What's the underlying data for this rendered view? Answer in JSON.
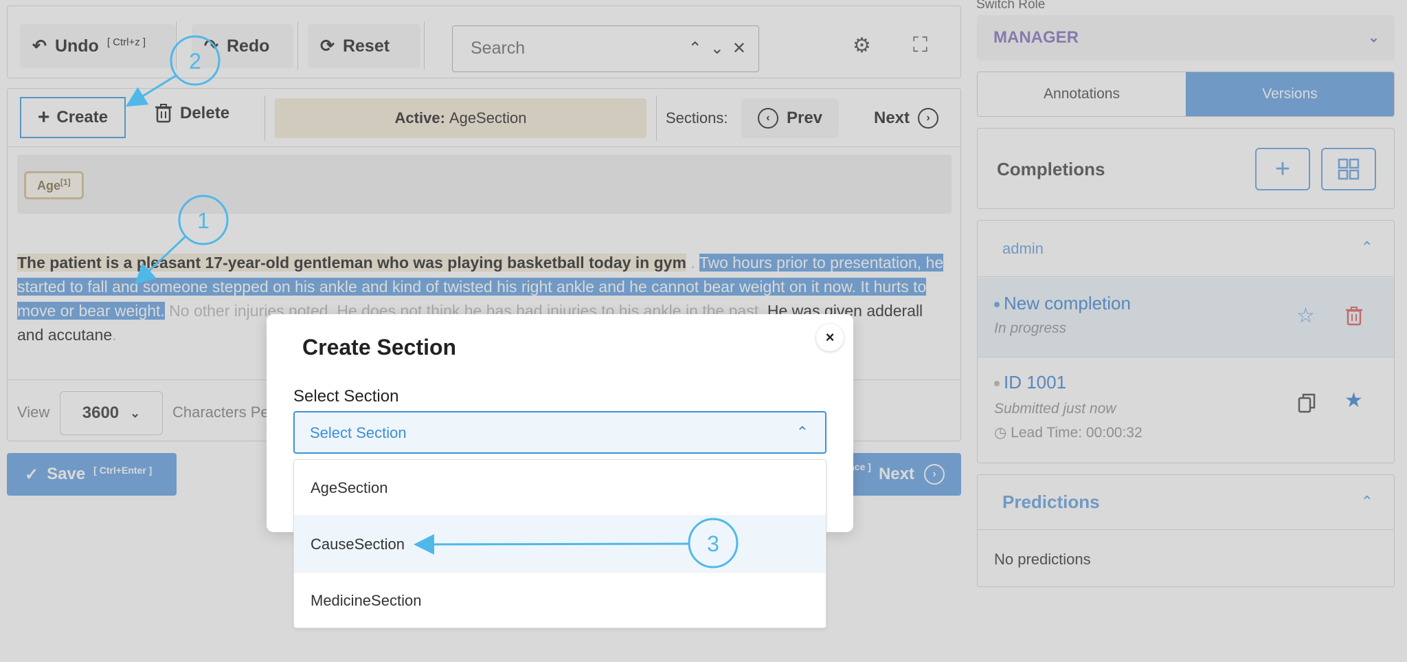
{
  "toolbar": {
    "undo_label": "Undo",
    "undo_shortcut": "[ Ctrl+z ]",
    "redo_label": "Redo",
    "reset_label": "Reset",
    "search_placeholder": "Search"
  },
  "section_toolbar": {
    "create_label": "Create",
    "delete_label": "Delete",
    "active_prefix": "Active:",
    "active_value": "AgeSection",
    "sections_label": "Sections:",
    "prev_label": "Prev",
    "next_label": "Next"
  },
  "labels": {
    "tag": "Age",
    "tag_index": "[1]"
  },
  "document": {
    "age_text": "The patient is a pleasant 17-year-old gentleman who was playing basketball today in gym",
    "selected_text": "Two hours prior to presentation, he started to fall and someone stepped on his ankle and kind of twisted his right ankle and he cannot bear weight on it now. It hurts to move or bear weight.",
    "faint_text": "No other injuries noted. He does not think he has had injuries to his ankle in the past.",
    "plain_text": "He was given adderall and accutane"
  },
  "footer": {
    "view_label": "View",
    "view_value": "3600",
    "chars_label": "Characters Pe"
  },
  "actions": {
    "save_label": "Save",
    "save_shortcut": "[ Ctrl+Enter ]",
    "next_label": "Next",
    "next_fragment": "ace ]"
  },
  "sidebar": {
    "role_label": "Switch Role",
    "role_value": "MANAGER",
    "tabs": [
      {
        "label": "Annotations",
        "active": false
      },
      {
        "label": "Versions",
        "active": true
      }
    ],
    "completions_title": "Completions",
    "group_user": "admin",
    "items": [
      {
        "title": "New completion",
        "status": "In progress"
      },
      {
        "title": "ID 1001",
        "status": "Submitted just now",
        "lead_time": "Lead Time: 00:00:32"
      }
    ],
    "predictions_title": "Predictions",
    "predictions_empty": "No predictions"
  },
  "modal": {
    "title": "Create Section",
    "close_label": "×",
    "select_label": "Select Section",
    "select_placeholder": "Select Section",
    "options": [
      "AgeSection",
      "CauseSection",
      "MedicineSection"
    ],
    "hovered_option": "CauseSection"
  },
  "annotations": {
    "marker_1": "1",
    "marker_2": "2",
    "marker_3": "3"
  },
  "colors": {
    "accent": "#6ea7e4",
    "annotation": "#4fb8e8",
    "role": "#8e7cc3",
    "age_highlight": "#f3ecd8"
  }
}
